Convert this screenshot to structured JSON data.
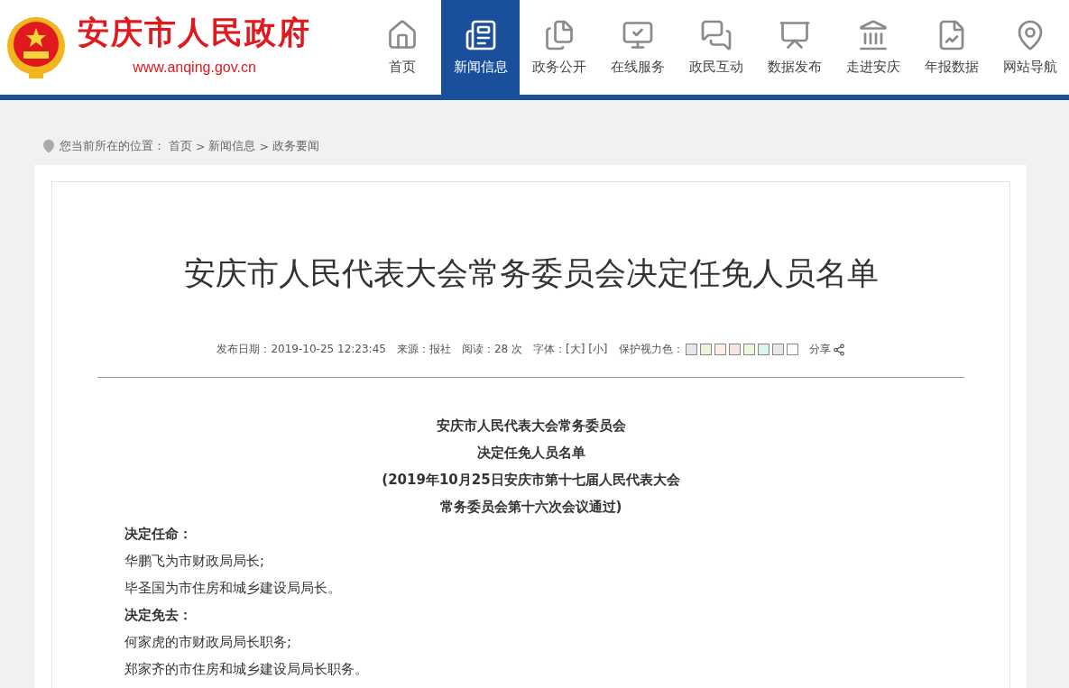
{
  "header": {
    "site_name": "安庆市人民政府",
    "url": "www.anqing.gov.cn"
  },
  "nav": [
    {
      "label": "首页",
      "selected": false
    },
    {
      "label": "新闻信息",
      "selected": true
    },
    {
      "label": "政务公开",
      "selected": false
    },
    {
      "label": "在线服务",
      "selected": false
    },
    {
      "label": "政民互动",
      "selected": false
    },
    {
      "label": "数据发布",
      "selected": false
    },
    {
      "label": "走进安庆",
      "selected": false
    },
    {
      "label": "年报数据",
      "selected": false
    },
    {
      "label": "网站导航",
      "selected": false
    }
  ],
  "breadcrumb": [
    "您当前所在的位置：",
    "首页",
    ">",
    "新闻信息",
    ">",
    "政务要闻"
  ],
  "article": {
    "title": "安庆市人民代表大会常务委员会决定任免人员名单",
    "meta": [
      "发布日期：2019-10-25 12:23:45",
      "来源：报社",
      "阅读：28 次",
      "字体：[大] [小]",
      "保护视力色："
    ],
    "swatches": [
      {
        "color": "#e3e8ef"
      },
      {
        "color": "#f1f2dc"
      },
      {
        "color": "#fdefe2"
      },
      {
        "color": "#fae3e0"
      },
      {
        "color": "#ecf7dc"
      },
      {
        "color": "#dcf4ee"
      },
      {
        "color": "#e7e7ee"
      },
      {
        "color": "#ffffff"
      }
    ],
    "share": "分享",
    "body": [
      {
        "kind": "center",
        "text": "安庆市人民代表大会常务委员会"
      },
      {
        "kind": "center",
        "text": "决定任免人员名单"
      },
      {
        "kind": "center",
        "text": "(2019年10月25日安庆市第十七届人民代表大会"
      },
      {
        "kind": "center",
        "text": "常务委员会第十六次会议通过)"
      },
      {
        "kind": "heading",
        "text": "决定任命："
      },
      {
        "kind": "text",
        "text": "华鹏飞为市财政局局长;"
      },
      {
        "kind": "text",
        "text": "毕圣国为市住房和城乡建设局局长。"
      },
      {
        "kind": "heading",
        "text": "决定免去："
      },
      {
        "kind": "text",
        "text": "何家虎的市财政局局长职务;"
      },
      {
        "kind": "text",
        "text": "郑家齐的市住房和城乡建设局局长职务。"
      }
    ]
  }
}
